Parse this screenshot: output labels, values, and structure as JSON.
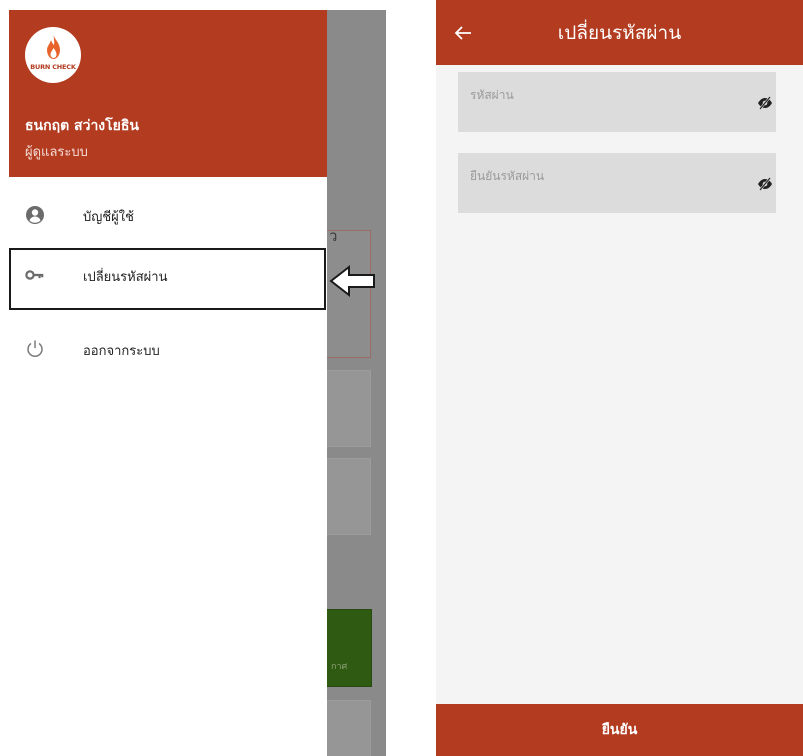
{
  "drawer": {
    "logo_text": "BURN CHECK",
    "user_name": "ธนกฤต สว่างโยธิน",
    "user_role": "ผู้ดูแลระบบ",
    "items": [
      {
        "label": "บัญชีผู้ใช้",
        "icon": "account-icon"
      },
      {
        "label": "เปลี่ยนรหัสผ่าน",
        "icon": "key-icon"
      },
      {
        "label": "ออกจากระบบ",
        "icon": "power-icon"
      }
    ]
  },
  "background": {
    "fragment": "ว",
    "green_label": "กาศ"
  },
  "change_password": {
    "title": "เปลี่ยนรหัสผ่าน",
    "password_placeholder": "รหัสผ่าน",
    "confirm_placeholder": "ยืนยันรหัสผ่าน",
    "confirm_button": "ยืนยัน"
  },
  "colors": {
    "brand": "#b23b20",
    "field_bg": "#dcdcdc",
    "overlay": "#8a8a8a"
  }
}
